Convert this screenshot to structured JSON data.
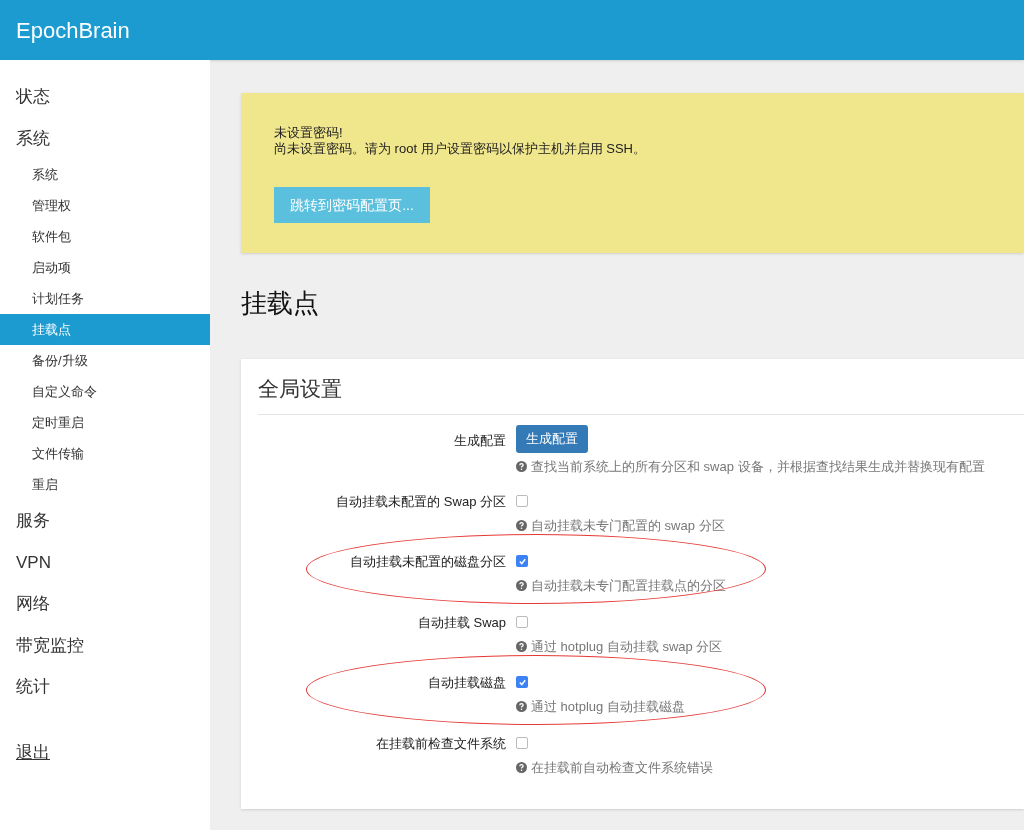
{
  "header": {
    "brand": "EpochBrain"
  },
  "sidebar": {
    "items": [
      {
        "label": "状态",
        "selected": false
      },
      {
        "label": "系统",
        "selected": false,
        "children": [
          {
            "label": "系统",
            "selected": false
          },
          {
            "label": "管理权",
            "selected": false
          },
          {
            "label": "软件包",
            "selected": false
          },
          {
            "label": "启动项",
            "selected": false
          },
          {
            "label": "计划任务",
            "selected": false
          },
          {
            "label": "挂载点",
            "selected": true
          },
          {
            "label": "备份/升级",
            "selected": false
          },
          {
            "label": "自定义命令",
            "selected": false
          },
          {
            "label": "定时重启",
            "selected": false
          },
          {
            "label": "文件传输",
            "selected": false
          },
          {
            "label": "重启",
            "selected": false
          }
        ]
      },
      {
        "label": "服务",
        "selected": false
      },
      {
        "label": "VPN",
        "selected": false
      },
      {
        "label": "网络",
        "selected": false
      },
      {
        "label": "带宽监控",
        "selected": false
      },
      {
        "label": "统计",
        "selected": false
      }
    ],
    "logout": "退出"
  },
  "alert": {
    "title": "未设置密码!",
    "message": "尚未设置密码。请为 root 用户设置密码以保护主机并启用 SSH。",
    "button": "跳转到密码配置页..."
  },
  "page_title": "挂载点",
  "section": {
    "title": "全局设置",
    "rows": [
      {
        "kind": "button",
        "label": "生成配置",
        "button": "生成配置",
        "help": "查找当前系统上的所有分区和 swap 设备，并根据查找结果生成并替换现有配置",
        "circled": false
      },
      {
        "kind": "checkbox",
        "label": "自动挂载未配置的 Swap 分区",
        "checked": false,
        "help": "自动挂载未专门配置的 swap 分区",
        "circled": false
      },
      {
        "kind": "checkbox",
        "label": "自动挂载未配置的磁盘分区",
        "checked": true,
        "help": "自动挂载未专门配置挂载点的分区",
        "circled": true
      },
      {
        "kind": "checkbox",
        "label": "自动挂载 Swap",
        "checked": false,
        "help": "通过 hotplug 自动挂载 swap 分区",
        "circled": false
      },
      {
        "kind": "checkbox",
        "label": "自动挂载磁盘",
        "checked": true,
        "help": "通过 hotplug 自动挂载磁盘",
        "circled": true
      },
      {
        "kind": "checkbox",
        "label": "在挂载前检查文件系统",
        "checked": false,
        "help": "在挂载前自动检查文件系统错误",
        "circled": false
      }
    ]
  }
}
